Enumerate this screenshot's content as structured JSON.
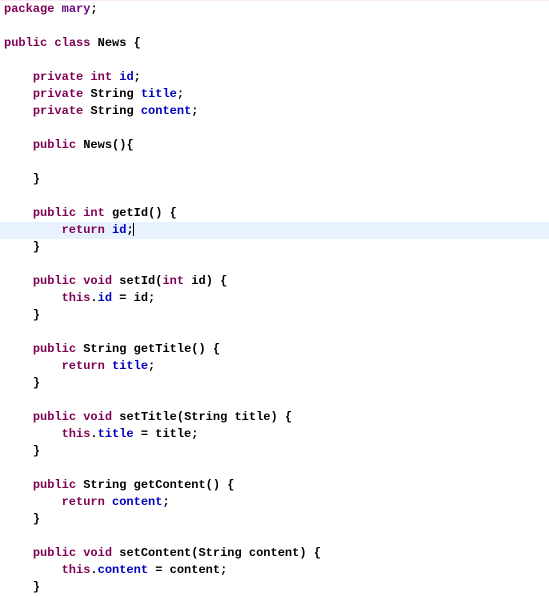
{
  "kw": {
    "package": "package",
    "public": "public",
    "class": "class",
    "private": "private",
    "int": "int",
    "void": "void",
    "return": "return",
    "this": "this"
  },
  "pkg": "mary",
  "cls": "News",
  "type_string": "String",
  "fields": {
    "id": "id",
    "title": "title",
    "content": "content"
  },
  "methods": {
    "ctor": "News",
    "getId": "getId",
    "setId": "setId",
    "getTitle": "getTitle",
    "setTitle": "setTitle",
    "getContent": "getContent",
    "setContent": "setContent"
  },
  "params": {
    "id": "id",
    "title": "title",
    "content": "content"
  },
  "sym": {
    "semi": ";",
    "obrace": "{",
    "cbrace": "}",
    "oparen": "(",
    "cparen": ")",
    "dot": ".",
    "eq": " = "
  },
  "indent1": "    ",
  "indent2": "        "
}
